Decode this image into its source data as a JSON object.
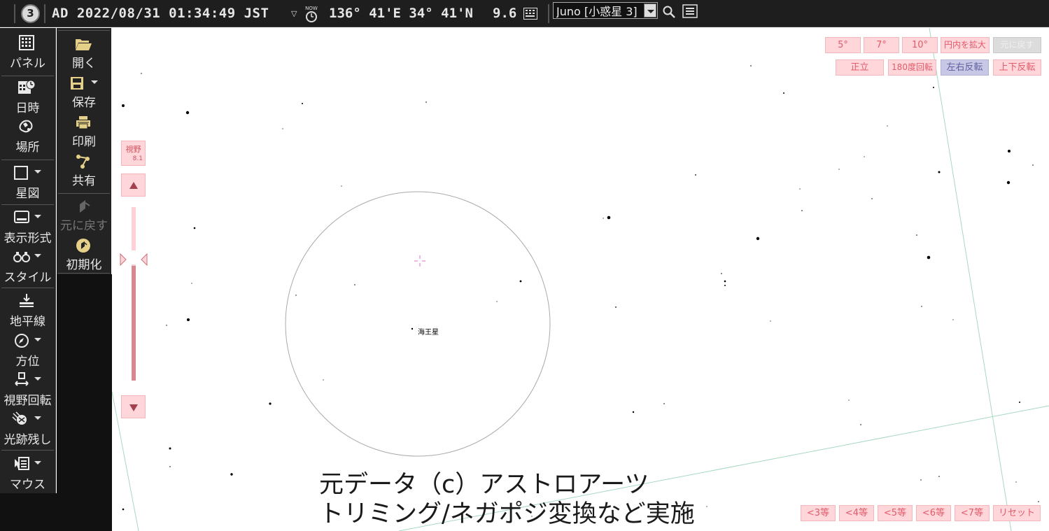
{
  "topbar": {
    "logo": "3",
    "datetime": "AD 2022/08/31 01:34:49 JST",
    "now_label": "NOW",
    "location": "136° 41'E 34° 41'N",
    "zoom": "9.6",
    "search_value": "Juno [小惑星 3]"
  },
  "toolbar_left": [
    {
      "label": "パネル",
      "icon": "panel-grid-icon"
    },
    {
      "label": "日時",
      "icon": "calendar-clock-icon"
    },
    {
      "label": "場所",
      "icon": "globe-location-icon"
    },
    {
      "label": "星図",
      "icon": "chart-frame-icon"
    },
    {
      "label": "表示形式",
      "icon": "monitor-icon"
    },
    {
      "label": "スタイル",
      "icon": "binoculars-icon"
    },
    {
      "label": "地平線",
      "icon": "horizon-icon"
    },
    {
      "label": "方位",
      "icon": "compass-icon"
    },
    {
      "label": "視野回転",
      "icon": "rotate-view-icon"
    },
    {
      "label": "光跡残し",
      "icon": "star-trail-icon"
    },
    {
      "label": "マウス",
      "icon": "mouse-mode-icon"
    }
  ],
  "toolbar_file": [
    {
      "label": "開く",
      "icon": "folder-open-icon"
    },
    {
      "label": "保存",
      "icon": "save-icon"
    },
    {
      "label": "印刷",
      "icon": "print-icon"
    },
    {
      "label": "共有",
      "icon": "share-icon"
    },
    {
      "label": "元に戻す",
      "icon": "undo-icon"
    },
    {
      "label": "初期化",
      "icon": "reset-icon"
    }
  ],
  "fov_buttons": [
    "5°",
    "7°",
    "10°",
    "円内を拡大",
    "元に戻す"
  ],
  "view_buttons": [
    "正立",
    "180度回転",
    "左右反転",
    "上下反転"
  ],
  "magnitude_buttons": [
    "<3等",
    "<4等",
    "<5等",
    "<6等",
    "<7等",
    "リセット"
  ],
  "fov_panel": {
    "label": "視野",
    "value": "8.1"
  },
  "sky": {
    "planet_label": "海王星"
  },
  "watermark": {
    "line1": "元データ（c）アストロアーツ",
    "line2": "トリミング/ネガポジ変換など実施"
  },
  "colors": {
    "toolbar_bg": "#232323",
    "pink_button": "#ffd6d9",
    "pink_text": "#e15b6a",
    "active_view": "#c8c8e6"
  }
}
